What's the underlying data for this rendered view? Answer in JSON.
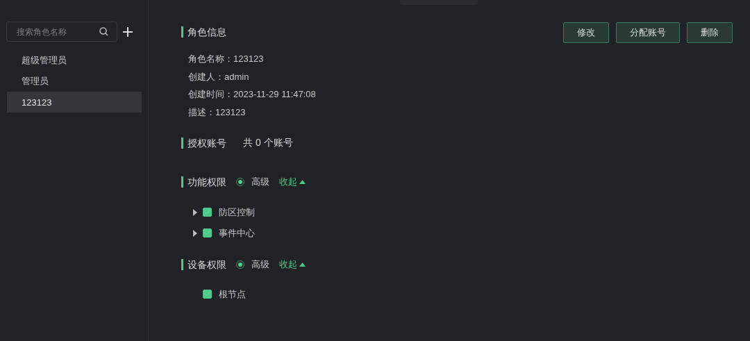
{
  "sidebar": {
    "search": {
      "placeholder": "搜索角色名称"
    },
    "items": [
      {
        "label": "超级管理员",
        "selected": false
      },
      {
        "label": "管理员",
        "selected": false
      },
      {
        "label": "123123",
        "selected": true
      }
    ]
  },
  "actions": [
    "修改",
    "分配账号",
    "删除"
  ],
  "role_info": {
    "title": "角色信息",
    "fields": [
      {
        "label": "角色名称：",
        "value": "123123"
      },
      {
        "label": "创建人：",
        "value": "admin"
      },
      {
        "label": "创建时间：",
        "value": "2023-11-29 11:47:08"
      },
      {
        "label": "描述：",
        "value": "123123"
      }
    ]
  },
  "accounts": {
    "title": "授权账号",
    "count_prefix": "共",
    "count": "0",
    "count_suffix": "个账号"
  },
  "permissions": [
    {
      "title": "功能权限",
      "mode": {
        "label": "高级",
        "selected": true
      },
      "toggle": {
        "label": "收起",
        "expanded": true
      },
      "nodes": [
        {
          "label": "防区控制",
          "checked": true,
          "kind": "branch"
        },
        {
          "label": "事件中心",
          "checked": true,
          "kind": "branch"
        }
      ]
    },
    {
      "title": "设备权限",
      "mode": {
        "label": "高级",
        "selected": true
      },
      "toggle": {
        "label": "收起",
        "expanded": true
      },
      "nodes": [
        {
          "label": "根节点",
          "checked": true,
          "kind": "leaf"
        }
      ]
    }
  ]
}
